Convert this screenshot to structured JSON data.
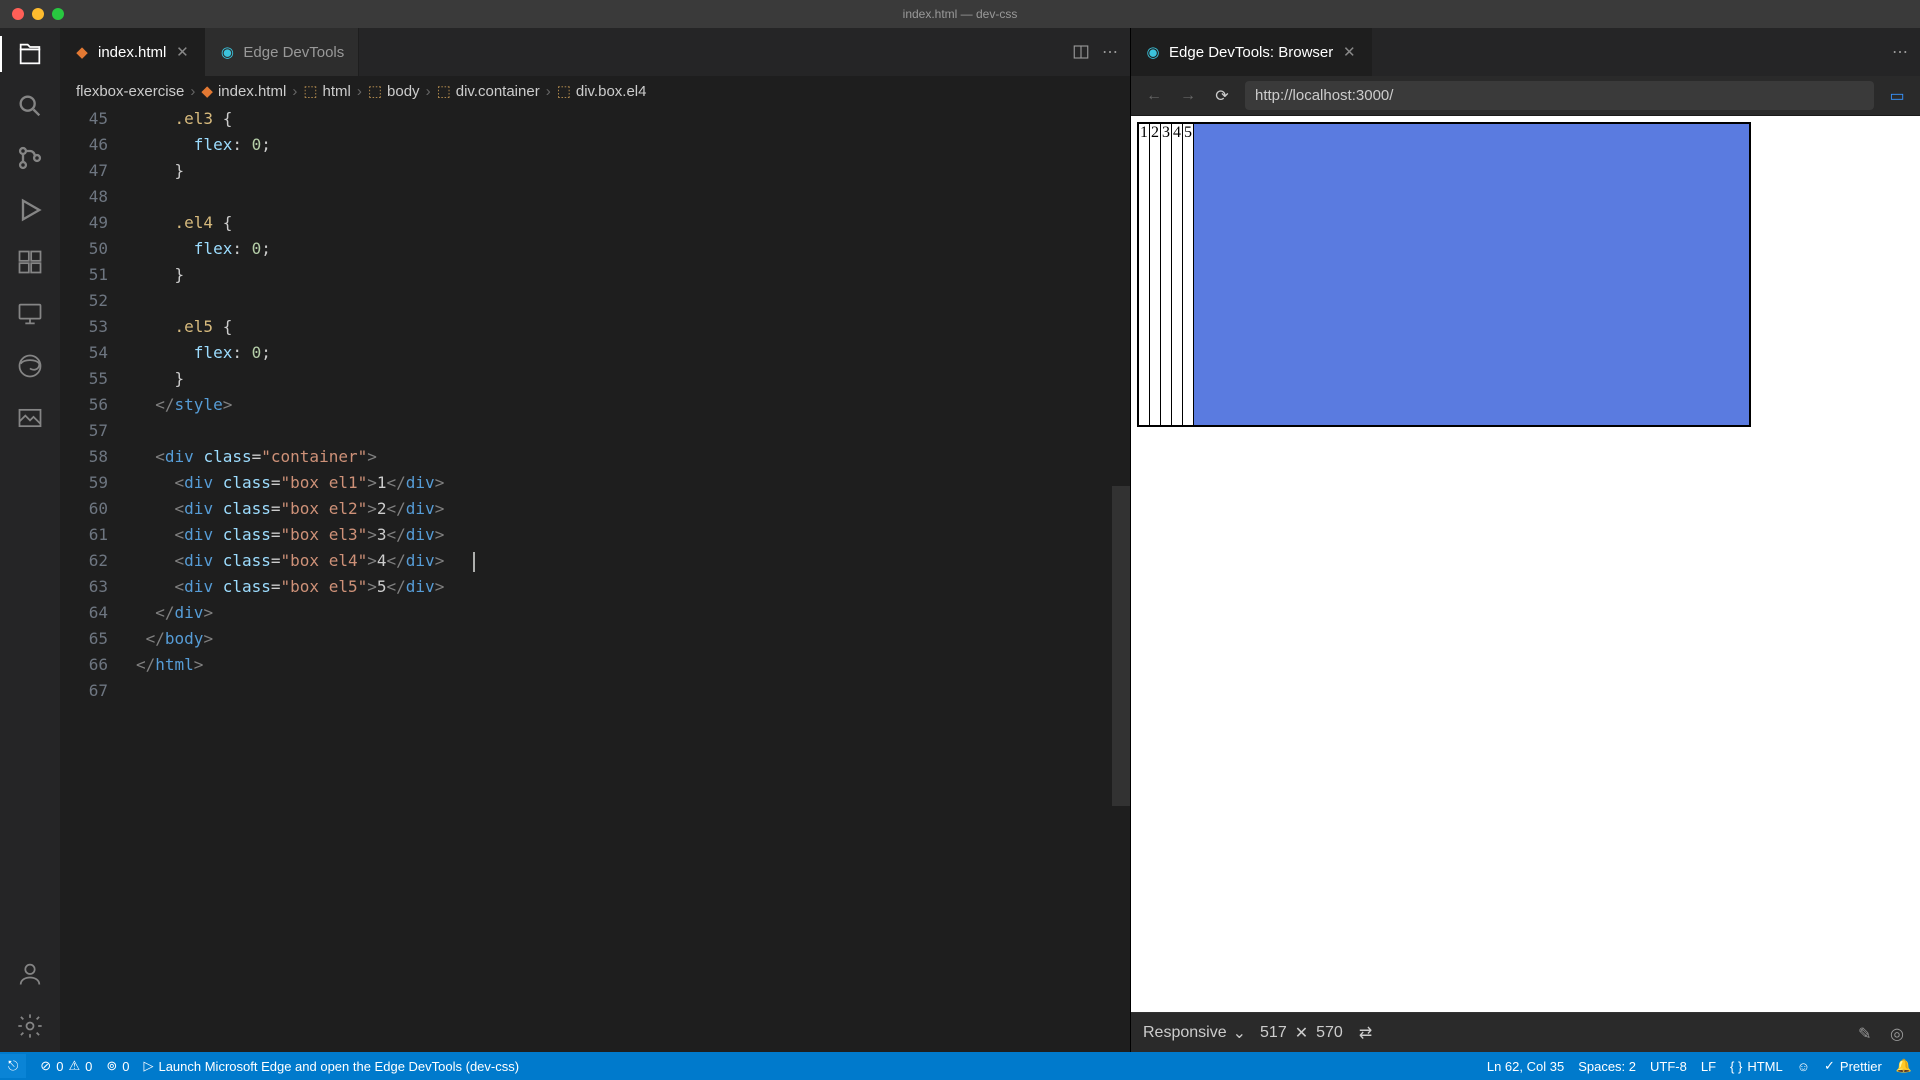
{
  "window_title": "index.html — dev-css",
  "tabs": [
    {
      "icon": "html-file-icon",
      "label": "index.html",
      "active": true
    },
    {
      "icon": "edge-icon",
      "label": "Edge DevTools",
      "active": false
    }
  ],
  "breadcrumb": {
    "folder": "flexbox-exercise",
    "path": [
      "index.html",
      "html",
      "body",
      "div.container",
      "div.box.el4"
    ]
  },
  "code_lines": [
    {
      "n": 45,
      "html": "    <span class='c-sel'>.el3</span> {"
    },
    {
      "n": 46,
      "html": "      <span class='c-prop'>flex</span>: <span class='c-num'>0</span>;"
    },
    {
      "n": 47,
      "html": "    }"
    },
    {
      "n": 48,
      "html": ""
    },
    {
      "n": 49,
      "html": "    <span class='c-sel'>.el4</span> {"
    },
    {
      "n": 50,
      "html": "      <span class='c-prop'>flex</span>: <span class='c-num'>0</span>;"
    },
    {
      "n": 51,
      "html": "    }"
    },
    {
      "n": 52,
      "html": ""
    },
    {
      "n": 53,
      "html": "    <span class='c-sel'>.el5</span> {"
    },
    {
      "n": 54,
      "html": "      <span class='c-prop'>flex</span>: <span class='c-num'>0</span>;"
    },
    {
      "n": 55,
      "html": "    }"
    },
    {
      "n": 56,
      "html": "  <span class='c-punc'>&lt;/</span><span class='c-tag'>style</span><span class='c-punc'>&gt;</span>"
    },
    {
      "n": 57,
      "html": ""
    },
    {
      "n": 58,
      "html": "  <span class='c-punc'>&lt;</span><span class='c-tag'>div</span> <span class='c-attr'>class</span>=<span class='c-str'>\"container\"</span><span class='c-punc'>&gt;</span>"
    },
    {
      "n": 59,
      "html": "    <span class='c-punc'>&lt;</span><span class='c-tag'>div</span> <span class='c-attr'>class</span>=<span class='c-str'>\"box el1\"</span><span class='c-punc'>&gt;</span>1<span class='c-punc'>&lt;/</span><span class='c-tag'>div</span><span class='c-punc'>&gt;</span>"
    },
    {
      "n": 60,
      "html": "    <span class='c-punc'>&lt;</span><span class='c-tag'>div</span> <span class='c-attr'>class</span>=<span class='c-str'>\"box el2\"</span><span class='c-punc'>&gt;</span>2<span class='c-punc'>&lt;/</span><span class='c-tag'>div</span><span class='c-punc'>&gt;</span>"
    },
    {
      "n": 61,
      "html": "    <span class='c-punc'>&lt;</span><span class='c-tag'>div</span> <span class='c-attr'>class</span>=<span class='c-str'>\"box el3\"</span><span class='c-punc'>&gt;</span>3<span class='c-punc'>&lt;/</span><span class='c-tag'>div</span><span class='c-punc'>&gt;</span>"
    },
    {
      "n": 62,
      "html": "    <span class='c-punc'>&lt;</span><span class='c-tag'>div</span> <span class='c-attr'>class</span>=<span class='c-str'>\"box el4\"</span><span class='c-punc'>&gt;</span>4<span class='c-punc'>&lt;/</span><span class='c-tag'>div</span><span class='c-punc'>&gt;</span>   <span class='caret'></span>"
    },
    {
      "n": 63,
      "html": "    <span class='c-punc'>&lt;</span><span class='c-tag'>div</span> <span class='c-attr'>class</span>=<span class='c-str'>\"box el5\"</span><span class='c-punc'>&gt;</span>5<span class='c-punc'>&lt;/</span><span class='c-tag'>div</span><span class='c-punc'>&gt;</span>"
    },
    {
      "n": 64,
      "html": "  <span class='c-punc'>&lt;/</span><span class='c-tag'>div</span><span class='c-punc'>&gt;</span>"
    },
    {
      "n": 65,
      "html": " <span class='c-punc'>&lt;/</span><span class='c-tag'>body</span><span class='c-punc'>&gt;</span>"
    },
    {
      "n": 66,
      "html": "<span class='c-punc'>&lt;/</span><span class='c-tag'>html</span><span class='c-punc'>&gt;</span>"
    },
    {
      "n": 67,
      "html": ""
    }
  ],
  "devtools": {
    "tab_label": "Edge DevTools: Browser",
    "url": "http://localhost:3000/",
    "boxes": [
      "1",
      "2",
      "3",
      "4",
      "5"
    ],
    "device": "Responsive",
    "width": "517",
    "height": "570"
  },
  "status": {
    "errors": "0",
    "warnings": "0",
    "port_fwd": "0",
    "launch": "Launch Microsoft Edge and open the Edge DevTools (dev-css)",
    "cursor": "Ln 62, Col 35",
    "spaces": "Spaces: 2",
    "encoding": "UTF-8",
    "eol": "LF",
    "lang": "HTML",
    "prettier": "Prettier"
  }
}
